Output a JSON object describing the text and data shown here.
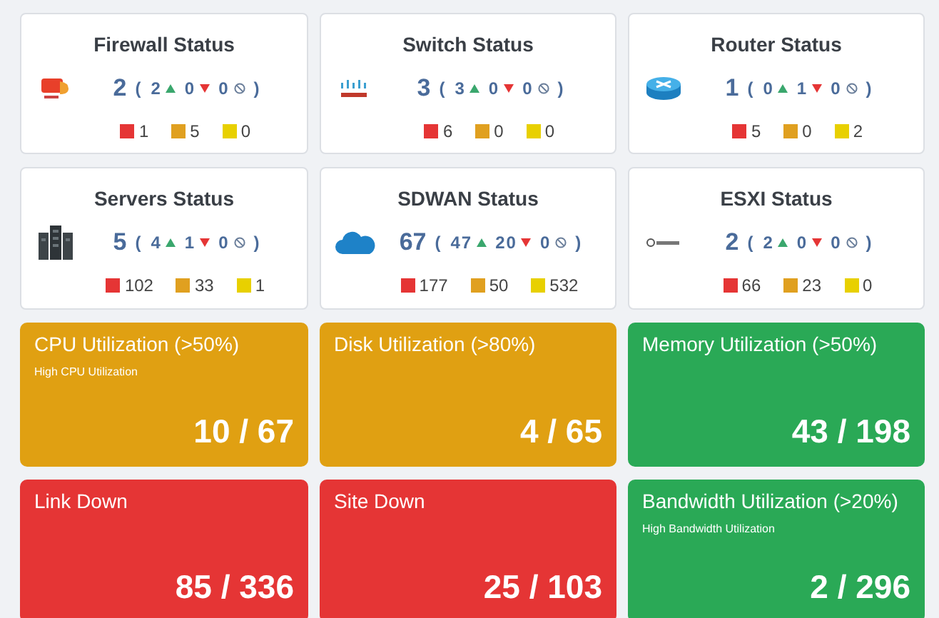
{
  "status_cards": [
    {
      "title": "Firewall Status",
      "kind": "firewall",
      "total": "2",
      "open": "(",
      "close": ")",
      "up": "2",
      "down": "0",
      "unknown": "0",
      "legend": [
        {
          "color": "#e53535",
          "count": "1"
        },
        {
          "color": "#e0a020",
          "count": "5"
        },
        {
          "color": "#e8d000",
          "count": "0"
        }
      ]
    },
    {
      "title": "Switch Status",
      "kind": "switch",
      "total": "3",
      "open": "(",
      "close": ")",
      "up": "3",
      "down": "0",
      "unknown": "0",
      "legend": [
        {
          "color": "#e53535",
          "count": "6"
        },
        {
          "color": "#e0a020",
          "count": "0"
        },
        {
          "color": "#e8d000",
          "count": "0"
        }
      ]
    },
    {
      "title": "Router Status",
      "kind": "router",
      "total": "1",
      "open": "(",
      "close": ")",
      "up": "0",
      "down": "1",
      "unknown": "0",
      "legend": [
        {
          "color": "#e53535",
          "count": "5"
        },
        {
          "color": "#e0a020",
          "count": "0"
        },
        {
          "color": "#e8d000",
          "count": "2"
        }
      ]
    },
    {
      "title": "Servers Status",
      "kind": "server",
      "total": "5",
      "open": "(",
      "close": ")",
      "up": "4",
      "down": "1",
      "unknown": "0",
      "legend": [
        {
          "color": "#e53535",
          "count": "102"
        },
        {
          "color": "#e0a020",
          "count": "33"
        },
        {
          "color": "#e8d000",
          "count": "1"
        }
      ]
    },
    {
      "title": "SDWAN Status",
      "kind": "cloud",
      "total": "67",
      "open": "(",
      "close": ")",
      "up": "47",
      "down": "20",
      "unknown": "0",
      "legend": [
        {
          "color": "#e53535",
          "count": "177"
        },
        {
          "color": "#e0a020",
          "count": "50"
        },
        {
          "color": "#e8d000",
          "count": "532"
        }
      ]
    },
    {
      "title": "ESXI Status",
      "kind": "vm",
      "total": "2",
      "open": "(",
      "close": ")",
      "up": "2",
      "down": "0",
      "unknown": "0",
      "legend": [
        {
          "color": "#e53535",
          "count": "66"
        },
        {
          "color": "#e0a020",
          "count": "23"
        },
        {
          "color": "#e8d000",
          "count": "0"
        }
      ]
    }
  ],
  "tiles": [
    {
      "title": "CPU Utilization (>50%)",
      "subtitle": "High CPU Utilization",
      "value": "10 / 67",
      "color": "#e0a012"
    },
    {
      "title": "Disk Utilization (>80%)",
      "value": "4 / 65",
      "color": "#e0a012"
    },
    {
      "title": "Memory Utilization (>50%)",
      "value": "43 / 198",
      "color": "#2aa956"
    },
    {
      "title": "Link Down",
      "value": "85 / 336",
      "color": "#e53535"
    },
    {
      "title": "Site Down",
      "value": "25 / 103",
      "color": "#e53535"
    },
    {
      "title": "Bandwidth Utilization (>20%)",
      "subtitle": "High Bandwidth Utilization",
      "value": "2 / 296",
      "color": "#2aa956"
    }
  ]
}
